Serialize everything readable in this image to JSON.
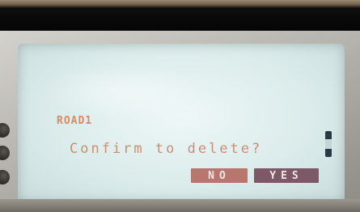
{
  "screen": {
    "record_name": "ROAD1",
    "prompt": "Confirm to delete?",
    "buttons": {
      "no_label": "NO",
      "yes_label": "YES"
    }
  },
  "colors": {
    "screen_background": "#dbeceb",
    "text_accent": "#d98963",
    "no_button": "#b8766f",
    "yes_button": "#7d5866"
  }
}
